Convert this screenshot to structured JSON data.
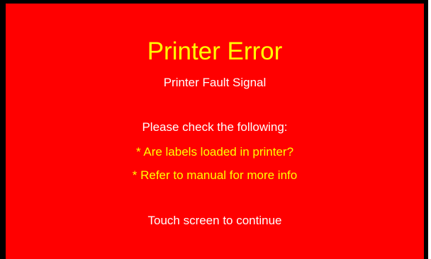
{
  "error": {
    "title": "Printer Error",
    "subtitle": "Printer Fault Signal"
  },
  "instructions": {
    "heading": "Please check the following:",
    "items": [
      "* Are labels loaded in printer?",
      "* Refer to manual for more info"
    ]
  },
  "prompt": {
    "continue_text": "Touch screen to continue"
  },
  "colors": {
    "background": "#ff0000",
    "title": "#ffff00",
    "normal_text": "#ffffff",
    "checklist_text": "#ffff00"
  }
}
